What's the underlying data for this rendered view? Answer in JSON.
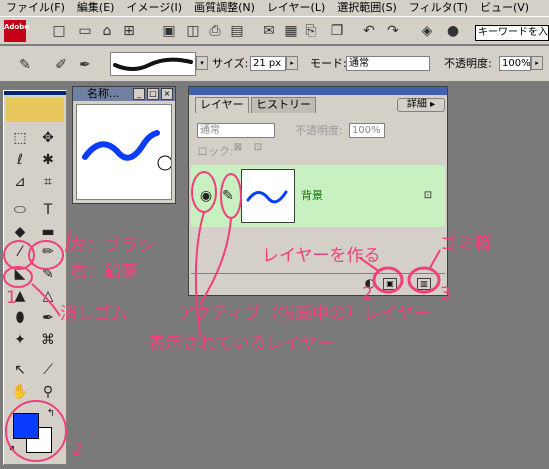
{
  "menubar": {
    "items": [
      "ファイル(F)",
      "編集(E)",
      "イメージ(I)",
      "画質調整(N)",
      "レイヤー(L)",
      "選択範囲(S)",
      "フィルタ(T)",
      "ビュー(V)"
    ]
  },
  "toolbar": {
    "logo_text": "Adobe",
    "search_placeholder": "キーワードを入力",
    "icons": [
      "new-file-icon",
      "open-folder-icon",
      "browse-icon",
      "save-icon",
      "save-web-icon",
      "print-icon",
      "undo-icon",
      "redo-icon",
      "help-icon"
    ]
  },
  "options": {
    "size_label": "サイズ:",
    "size_value": "21 px",
    "mode_label": "モード:",
    "mode_value": "通常",
    "opacity_label": "不透明度:",
    "opacity_value": "100%"
  },
  "navigator": {
    "title": "名称..."
  },
  "layers": {
    "tab_layers": "レイヤー",
    "tab_history": "ヒストリー",
    "detail_button": "詳細",
    "blend_mode": "通常",
    "opacity_label": "不透明度:",
    "opacity_value": "100%",
    "lock_label": "ロック:",
    "layer_name": "背景"
  },
  "annotations": {
    "left_brush": "左：ブラシ",
    "right_pencil": "右：鉛筆",
    "eraser": "消しゴム",
    "active_layer": "アクティブ（描画中の）レイヤー",
    "visible_layer": "表示されているレイヤー",
    "make_layer": "レイヤーを作る",
    "trash": "ゴミ箱",
    "num_eraser": "1",
    "num_make": "2",
    "num_trash": "3",
    "num_swatch": "2"
  },
  "colors": {
    "annotation": "#f0407a",
    "stroke_blue": "#0a3cff",
    "layer_highlight": "#c8f0c0"
  }
}
